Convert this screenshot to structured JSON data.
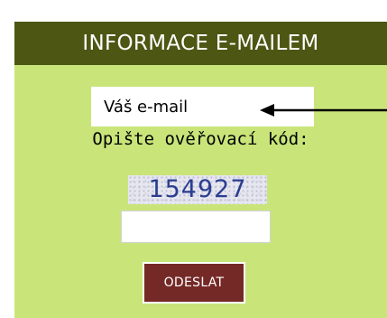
{
  "form": {
    "header_title": "INFORMACE E-MAILEM",
    "email_placeholder": "Váš e-mail",
    "captcha_label": "Opište ověřovací kód:",
    "captcha_code": "154927",
    "submit_label": "ODESLAT"
  },
  "colors": {
    "header_background": "#4e5614",
    "panel_background": "#c9e57a",
    "captcha_text": "#2a3d8f",
    "submit_background": "#742926"
  },
  "icons": {
    "annotation_arrow": "arrow-left-icon"
  }
}
